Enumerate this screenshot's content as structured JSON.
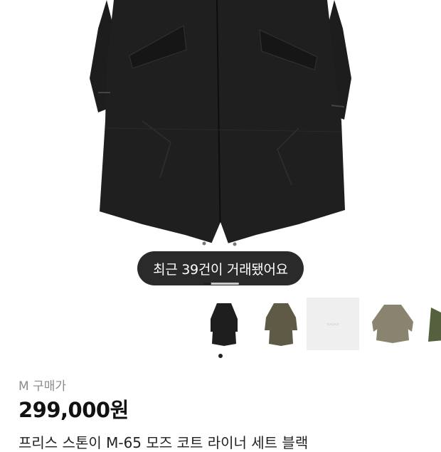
{
  "toast": {
    "text": "최근 39건이 거래됐어요"
  },
  "gallery": {
    "progress": 0.25,
    "thumbnails": [
      {
        "name": "black parka",
        "color": "#1e1e1e"
      },
      {
        "name": "olive parka",
        "color": "#5f5a45"
      },
      {
        "name": "placeholder",
        "color": "#efefef"
      },
      {
        "name": "beige olive parka",
        "color": "#8a8370"
      },
      {
        "name": "green parka",
        "color": "#55603f"
      }
    ]
  },
  "product": {
    "size_label": "M 구매가",
    "price": "299,000원",
    "title": "프리스 스톤이 M-65 모즈 코트 라이너 세트 블랙"
  }
}
